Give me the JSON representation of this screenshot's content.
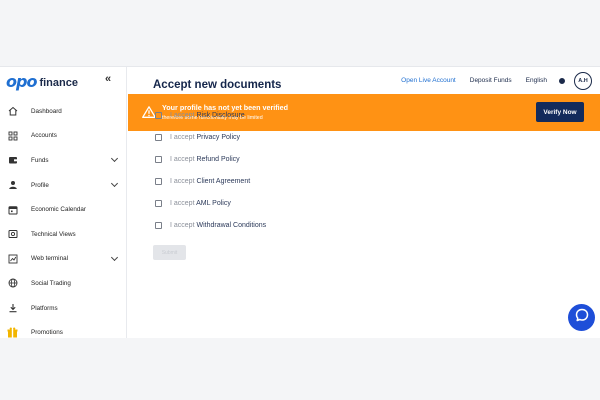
{
  "brand": {
    "logo_mark": "opo",
    "logo_text": "finance"
  },
  "sidebar": {
    "collapse_icon": "«",
    "items": [
      {
        "label": "Dashboard",
        "icon": "home-icon",
        "has_chevron": false
      },
      {
        "label": "Accounts",
        "icon": "accounts-grid-icon",
        "has_chevron": false
      },
      {
        "label": "Funds",
        "icon": "wallet-icon",
        "has_chevron": true
      },
      {
        "label": "Profile",
        "icon": "user-icon",
        "has_chevron": true
      },
      {
        "label": "Economic Calendar",
        "icon": "calendar-icon",
        "has_chevron": false
      },
      {
        "label": "Technical Views",
        "icon": "technical-views-icon",
        "has_chevron": false
      },
      {
        "label": "Web terminal",
        "icon": "terminal-chart-icon",
        "has_chevron": true
      },
      {
        "label": "Social Trading",
        "icon": "globe-icon",
        "has_chevron": false
      },
      {
        "label": "Platforms",
        "icon": "download-icon",
        "has_chevron": false
      },
      {
        "label": "Promotions",
        "icon": "gift-icon",
        "has_chevron": false
      }
    ]
  },
  "header": {
    "open_live_account": "Open Live Account",
    "deposit_funds": "Deposit Funds",
    "language": "English",
    "avatar_initials": "A.H"
  },
  "banner": {
    "title": "Your profile has not yet been verified",
    "subtitle": "therefore some functionality may be limited",
    "button": "Verify Now",
    "color": "#ff9214"
  },
  "main": {
    "title": "Accept new documents",
    "accept_prefix": "I accept",
    "documents": [
      "Risk Disclosure",
      "Privacy Policy",
      "Refund Policy",
      "Client Agreement",
      "AML Policy",
      "Withdrawal Conditions"
    ],
    "submit": "Submit"
  },
  "colors": {
    "accent": "#1f6fd1",
    "navy": "#132b5c",
    "chat": "#1e4ed8"
  }
}
